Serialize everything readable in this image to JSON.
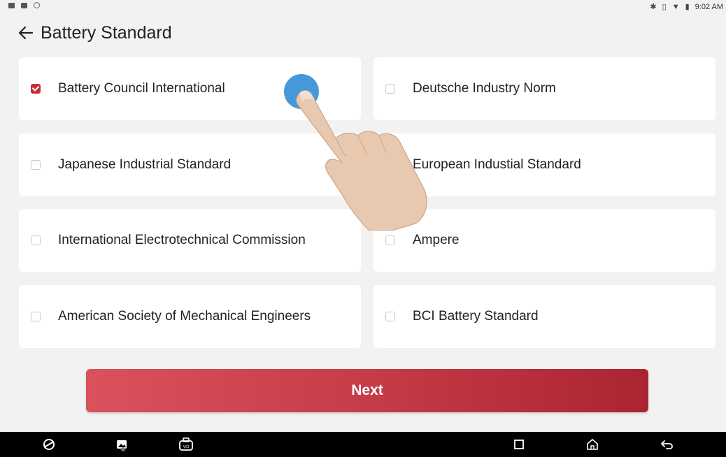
{
  "status_bar": {
    "time": "9:02 AM",
    "left_icons": [
      "image-notification-icon",
      "message-notification-icon",
      "settings-notification-icon"
    ],
    "right_icons": [
      "bluetooth-icon",
      "vibrate-icon",
      "wifi-icon",
      "battery-icon"
    ]
  },
  "header": {
    "back_icon": "arrow-left-icon",
    "title": "Battery Standard"
  },
  "options": [
    {
      "label": "Battery Council International",
      "checked": true
    },
    {
      "label": "Deutsche Industry Norm",
      "checked": false
    },
    {
      "label": "Japanese Industrial Standard",
      "checked": false
    },
    {
      "label": "European Industial Standard",
      "checked": false
    },
    {
      "label": "International Electrotechnical Commission",
      "checked": false
    },
    {
      "label": "Ampere",
      "checked": false
    },
    {
      "label": "American Society of Mechanical Engineers",
      "checked": false
    },
    {
      "label": "BCI Battery Standard",
      "checked": false
    }
  ],
  "next_button": {
    "label": "Next"
  },
  "nav_bar": {
    "buttons": [
      "browser-icon",
      "gallery-icon",
      "vci-icon",
      "recents-icon",
      "home-icon",
      "back-icon"
    ],
    "vci_text": "VCI"
  },
  "colors": {
    "accent": "#c62e36",
    "button_start": "#d9525c",
    "button_end": "#ab2432",
    "background": "#f2f2f2",
    "touch_indicator": "#3d92d6"
  }
}
